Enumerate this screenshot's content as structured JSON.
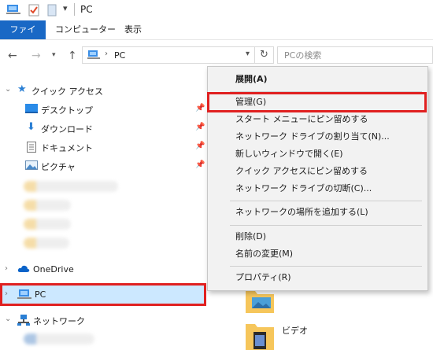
{
  "window": {
    "title": "PC"
  },
  "ribbon": {
    "tabs": [
      "ファイル",
      "コンピューター",
      "表示"
    ]
  },
  "address": {
    "location": "PC",
    "search_placeholder": "PCの検索"
  },
  "nav": {
    "quick_access": "クイック アクセス",
    "quick_items": [
      "デスクトップ",
      "ダウンロード",
      "ドキュメント",
      "ピクチャ"
    ],
    "onedrive": "OneDrive",
    "pc": "PC",
    "network": "ネットワーク"
  },
  "content": {
    "video_label": "ビデオ"
  },
  "context_menu": {
    "items": [
      "展開(A)",
      "管理(G)",
      "スタート メニューにピン留めする",
      "ネットワーク ドライブの割り当て(N)...",
      "新しいウィンドウで開く(E)",
      "クイック アクセスにピン留めする",
      "ネットワーク ドライブの切断(C)...",
      "ネットワークの場所を追加する(L)",
      "削除(D)",
      "名前の変更(M)",
      "プロパティ(R)"
    ]
  },
  "colors": {
    "accent": "#1968c5",
    "highlight": "#e02020",
    "selection": "#cce8ff"
  }
}
